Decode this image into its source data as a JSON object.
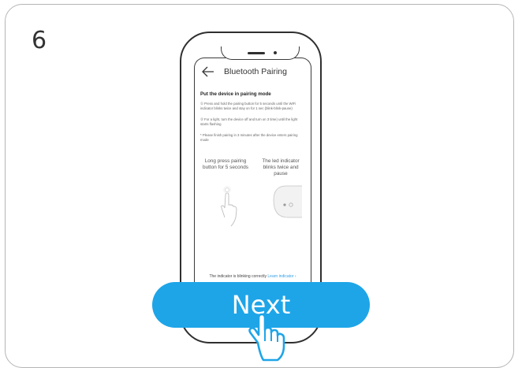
{
  "step": {
    "number": "6"
  },
  "screen": {
    "title": "Bluetooth Pairing",
    "back_icon": "arrow-left-icon",
    "heading": "Put the device in pairing mode",
    "instructions": [
      "① Press and hold the pairing button for 5 seconds until the WiFi indicator blinks twice and stay on for 1 sec (blink-blink-pause)",
      "② For a light, turn the device off and turn on 3 time) until the light starts flashing",
      "* Please finish pairing in 3 minutes after the device enters pairing mode"
    ],
    "illustrations": [
      {
        "label": "Long press pairing button for 5 seconds",
        "icon": "finger-press-icon"
      },
      {
        "label": "The led indicator blinks twice and pause",
        "icon": "device-led-icon"
      }
    ],
    "footer": {
      "text": "The indicator is blinking correctly",
      "link": "Learn indicator ›"
    }
  },
  "next_button": {
    "label": "Next"
  },
  "pointer_icon": "hand-pointer-icon",
  "colors": {
    "accent": "#1ea5e8",
    "link": "#2f9fe5",
    "frame": "#2f2f2f"
  }
}
